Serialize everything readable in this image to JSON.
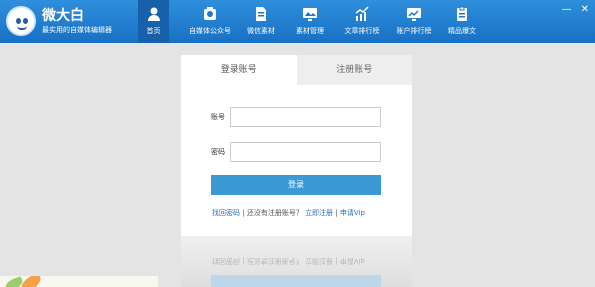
{
  "brand": {
    "name": "微大白",
    "slogan": "最实用的自媒体编辑器"
  },
  "nav": [
    {
      "label": "首页",
      "icon": "home-icon",
      "active": true
    },
    {
      "label": "自媒体公众号",
      "icon": "wechat-account-icon",
      "active": false
    },
    {
      "label": "微信素材",
      "icon": "document-icon",
      "active": false
    },
    {
      "label": "素材管理",
      "icon": "image-manage-icon",
      "active": false
    },
    {
      "label": "文章排行榜",
      "icon": "trend-chart-icon",
      "active": false
    },
    {
      "label": "账户排行榜",
      "icon": "monitor-chart-icon",
      "active": false
    },
    {
      "label": "精品爆文",
      "icon": "clipboard-icon",
      "active": false
    }
  ],
  "window_controls": {
    "minimize": "—",
    "close": "✕"
  },
  "login": {
    "tab_login": "登录账号",
    "tab_register": "注册账号",
    "account_label": "账号",
    "password_label": "密码",
    "account_value": "",
    "password_value": "",
    "submit": "登录",
    "links": {
      "forgot": "找回密码",
      "sep1": "|",
      "no_account": "还没有注册账号？",
      "register": "立即注册",
      "sep2": "|",
      "apply_vip": "申请Vip"
    },
    "reflection_text": "找回密码 | 还没有注册账号？ 立即注册 | 申请Vip"
  },
  "colors": {
    "topbar": "#2480d0",
    "active_nav": "#1761ab",
    "button": "#3b9ad3",
    "link": "#2a6fb8",
    "background": "#e4e4e4"
  }
}
